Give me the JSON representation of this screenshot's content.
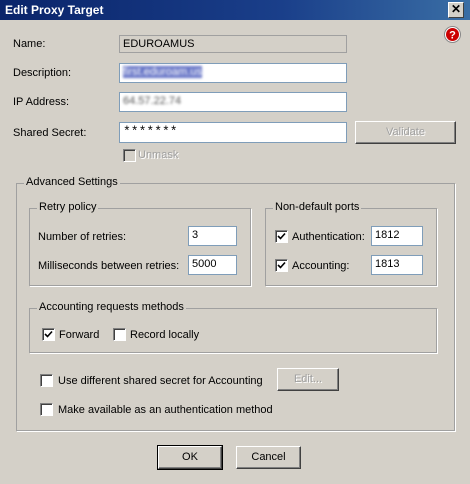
{
  "window": {
    "title": "Edit Proxy Target",
    "close_glyph": "✕"
  },
  "form": {
    "name_label": "Name:",
    "name_value": "EDUROAMUS",
    "description_label": "Description:",
    "description_value": "first.eduroam.us",
    "ip_label": "IP Address:",
    "ip_value": "64.57.22.74",
    "secret_label": "Shared Secret:",
    "secret_value": "*******",
    "validate_button": "Validate",
    "unmask_label": "Unmask",
    "unmask_checked": false
  },
  "advanced": {
    "title": "Advanced Settings",
    "retry": {
      "title": "Retry policy",
      "retries_label": "Number of retries:",
      "retries_value": "3",
      "ms_label": "Milliseconds between retries:",
      "ms_value": "5000"
    },
    "ports": {
      "title": "Non-default ports",
      "auth_label": "Authentication:",
      "auth_checked": true,
      "auth_value": "1812",
      "acct_label": "Accounting:",
      "acct_checked": true,
      "acct_value": "1813"
    },
    "methods": {
      "title": "Accounting requests methods",
      "forward_label": "Forward",
      "forward_checked": true,
      "record_label": "Record locally",
      "record_checked": false
    },
    "diff_secret_label": "Use different shared secret for Accounting",
    "diff_secret_checked": false,
    "edit_button": "Edit...",
    "auth_method_label": "Make available as an authentication method",
    "auth_method_checked": false
  },
  "buttons": {
    "ok": "OK",
    "cancel": "Cancel"
  },
  "icons": {
    "help": "help-icon",
    "close": "close-icon",
    "check": "checkmark-icon"
  },
  "colors": {
    "title_bar": "#0a246a",
    "window_bg": "#d4d0c8",
    "help_red": "#cc0000"
  }
}
